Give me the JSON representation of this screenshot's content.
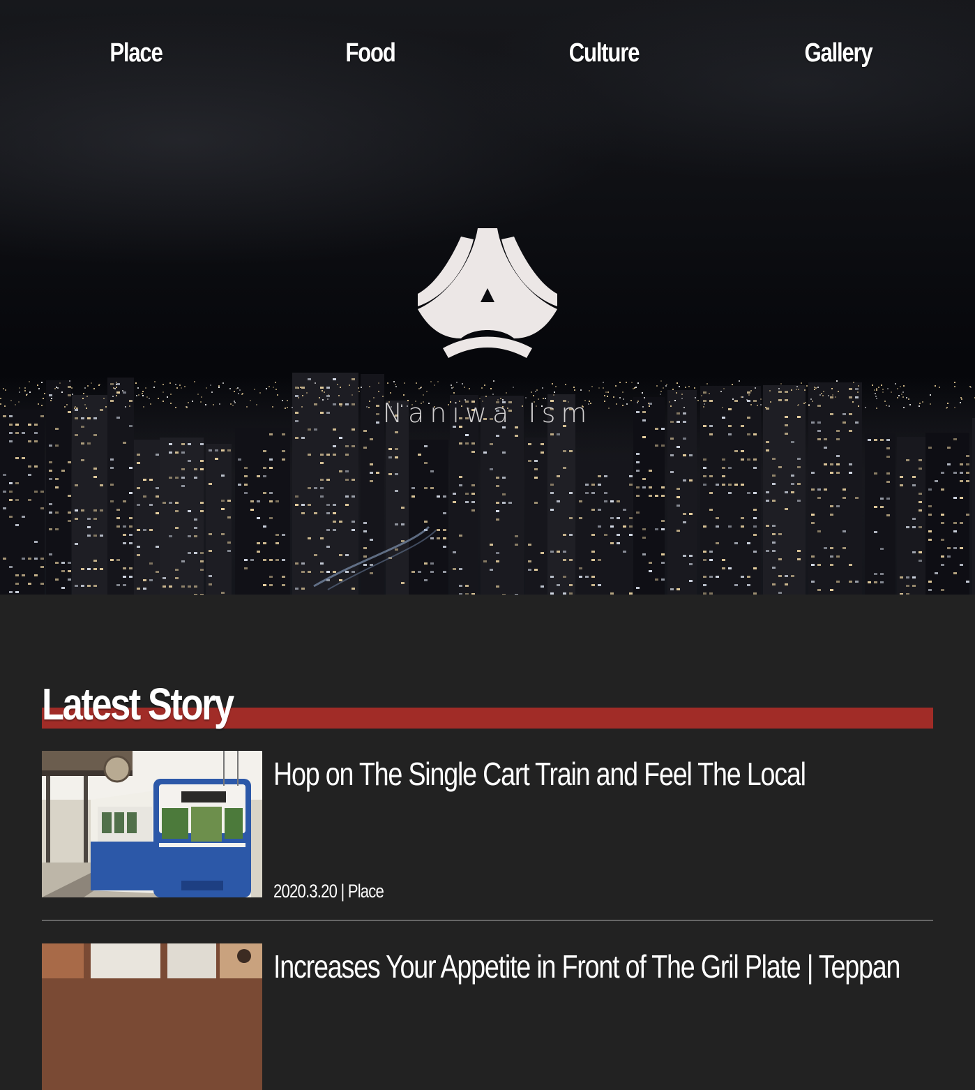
{
  "nav": {
    "items": [
      {
        "label": "Place"
      },
      {
        "label": "Food"
      },
      {
        "label": "Culture"
      },
      {
        "label": "Gallery"
      }
    ]
  },
  "hero": {
    "logo_text": "Naniwa Ism",
    "logo_color": "#ece7e6"
  },
  "latest": {
    "heading": "Latest Story",
    "accent_color": "#a12c27",
    "stories": [
      {
        "title": "Hop on The Single Cart Train and Feel The Local",
        "date": "2020.3.20",
        "separator": "|",
        "category": "Place"
      },
      {
        "title": "Increases Your Appetite in Front of The Gril Plate | Teppan"
      }
    ]
  }
}
